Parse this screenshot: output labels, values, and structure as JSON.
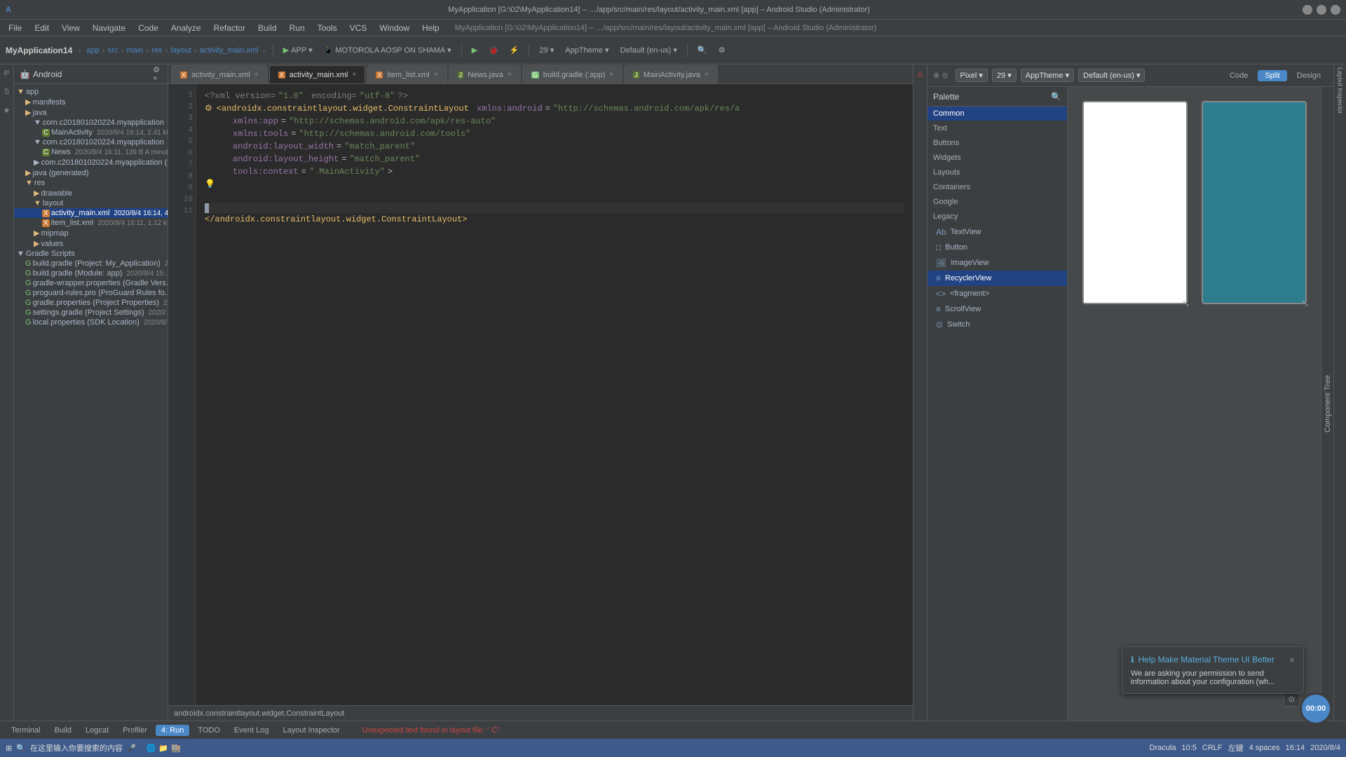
{
  "titleBar": {
    "title": "MyApplication [G:\\02\\MyApplication14] – …/app/src/main/res/layout/activity_main.xml [app] – Android Studio (Administrator)",
    "windowControls": [
      "minimize",
      "maximize",
      "close"
    ]
  },
  "menuBar": {
    "items": [
      "File",
      "Edit",
      "View",
      "Navigate",
      "Code",
      "Analyze",
      "Refactor",
      "Build",
      "Run",
      "Tools",
      "VCS",
      "Window",
      "Help"
    ]
  },
  "toolbar": {
    "appName": "MyApplication14",
    "breadcrumb": [
      "app",
      "src",
      "main",
      "res",
      "layout",
      "activity_main.xml"
    ],
    "runConfig": "APP",
    "device": "MOTOROLA AOSP ON SHAMA",
    "sdkDropdown": "29",
    "themeDropdown": "AppTheme",
    "localeDropdown": "Default (en-us)"
  },
  "projectPanel": {
    "header": "Android",
    "items": [
      {
        "label": "app",
        "indent": 0,
        "type": "root",
        "icon": "▼"
      },
      {
        "label": "manifests",
        "indent": 1,
        "type": "folder",
        "icon": "▶"
      },
      {
        "label": "java",
        "indent": 1,
        "type": "folder",
        "icon": "▶"
      },
      {
        "label": "com.c201801020224.myapplication",
        "indent": 2,
        "type": "package",
        "icon": "▼"
      },
      {
        "label": "MainActivity",
        "indent": 3,
        "type": "java",
        "icon": "C",
        "meta": "2020/8/4 16:14, 2.41 kB"
      },
      {
        "label": "com.c201801020224.myapplication",
        "indent": 2,
        "type": "package2",
        "icon": "▼"
      },
      {
        "label": "News",
        "indent": 3,
        "type": "java",
        "icon": "C",
        "meta": "2020/8/4 16:11, 139 B A minut..."
      },
      {
        "label": "com.c201801020224.myapplication (t...",
        "indent": 2,
        "type": "package3",
        "icon": "▶"
      },
      {
        "label": "java (generated)",
        "indent": 1,
        "type": "folder",
        "icon": "▶"
      },
      {
        "label": "res",
        "indent": 1,
        "type": "folder",
        "icon": "▼"
      },
      {
        "label": "drawable",
        "indent": 2,
        "type": "folder",
        "icon": "▶"
      },
      {
        "label": "layout",
        "indent": 2,
        "type": "folder",
        "icon": "▼"
      },
      {
        "label": "activity_main.xml",
        "indent": 3,
        "type": "xml",
        "icon": "X",
        "meta": "2020/8/4 16:14, 44..."
      },
      {
        "label": "item_list.xml",
        "indent": 3,
        "type": "xml",
        "icon": "X",
        "meta": "2020/8/4 16:11, 1.12 kB"
      },
      {
        "label": "mipmap",
        "indent": 2,
        "type": "folder",
        "icon": "▶"
      },
      {
        "label": "values",
        "indent": 2,
        "type": "folder",
        "icon": "▶"
      },
      {
        "label": "Gradle Scripts",
        "indent": 0,
        "type": "gradle-root",
        "icon": "▼"
      },
      {
        "label": "build.gradle (Project: My_Application)",
        "indent": 1,
        "type": "gradle",
        "icon": "G",
        "meta": "2..."
      },
      {
        "label": "build.gradle (Module: app)",
        "indent": 1,
        "type": "gradle",
        "icon": "G",
        "meta": "2020/8/4 15:..."
      },
      {
        "label": "gradle-wrapper.properties (Gradle Vers...",
        "indent": 1,
        "type": "gradle",
        "icon": "G"
      },
      {
        "label": "proguard-rules.pro (ProGuard Rules fo...",
        "indent": 1,
        "type": "gradle",
        "icon": "G"
      },
      {
        "label": "gradle.properties (Project Properties)",
        "indent": 1,
        "type": "gradle",
        "icon": "G",
        "meta": "2..."
      },
      {
        "label": "settings.gradle (Project Settings)",
        "indent": 1,
        "type": "gradle",
        "icon": "G",
        "meta": "2020/..."
      },
      {
        "label": "local.properties (SDK Location)",
        "indent": 1,
        "type": "gradle",
        "icon": "G",
        "meta": "2020/8/..."
      }
    ]
  },
  "editorTabs": [
    {
      "label": "activity_main.xml",
      "active": true,
      "icon": "X"
    },
    {
      "label": "item_list.xml",
      "active": false,
      "icon": "X"
    },
    {
      "label": "News.java",
      "active": false,
      "icon": "J"
    },
    {
      "label": "build.gradle (:app)",
      "active": false,
      "icon": "G"
    },
    {
      "label": "MainActivity.java",
      "active": false,
      "icon": "J"
    }
  ],
  "codeLines": [
    {
      "num": 1,
      "content": "<?xml version=\"1.0\" encoding=\"utf-8\"?>"
    },
    {
      "num": 2,
      "content": "<androidx.constraintlayout.widget.ConstraintLayout xmlns:android=\"http://schemas.android.com/apk/res/a"
    },
    {
      "num": 3,
      "content": "    xmlns:app=\"http://schemas.android.com/apk/res-auto\""
    },
    {
      "num": 4,
      "content": "    xmlns:tools=\"http://schemas.android.com/tools\""
    },
    {
      "num": 5,
      "content": "    android:layout_width=\"match_parent\""
    },
    {
      "num": 6,
      "content": "    android:layout_height=\"match_parent\""
    },
    {
      "num": 7,
      "content": "    tools:context=\".MainActivity\">"
    },
    {
      "num": 8,
      "content": ""
    },
    {
      "num": 9,
      "content": ""
    },
    {
      "num": 10,
      "content": ""
    },
    {
      "num": 11,
      "content": "</androidx.constraintlayout.widget.ConstraintLayout>"
    }
  ],
  "palette": {
    "header": "Palette",
    "searchPlaceholder": "Search...",
    "categories": [
      "Common",
      "Text",
      "Buttons",
      "Widgets",
      "Layouts",
      "Containers",
      "Google",
      "Legacy"
    ],
    "selectedCategory": "Common",
    "items": [
      {
        "label": "TextView",
        "icon": "Ab"
      },
      {
        "label": "Button",
        "icon": "□"
      },
      {
        "label": "ImageView",
        "icon": "🖼"
      },
      {
        "label": "RecyclerView",
        "icon": "≡"
      },
      {
        "label": "<fragment>",
        "icon": "<>"
      },
      {
        "label": "ScrollView",
        "icon": "≡"
      },
      {
        "label": "Switch",
        "icon": "⊙"
      }
    ],
    "selectedItem": "RecyclerView"
  },
  "designToolbar": {
    "modes": [
      "Code",
      "Split",
      "Design"
    ],
    "activeMode": "Split",
    "pixelDropdown": "Pixel",
    "sdkDropdown": "29",
    "themeDropdown": "AppTheme",
    "localeDropdown": "Default (en-us)"
  },
  "componentTree": {
    "label": "Component Tree"
  },
  "bottomBar": {
    "path": "androidx.constraintlayout.widget.ConstraintLayout",
    "statusText": "Unexpected text found in layout file: \" C\"",
    "statusTabs": [
      "Terminal",
      "Build",
      "Logcat",
      "Profiler"
    ],
    "rightInfo": {
      "run": "4: Run",
      "todo": "TODO"
    }
  },
  "ideStatusBar": {
    "theme": "Dracula",
    "line": "10",
    "col": "5",
    "lineEnding": "CRLF",
    "encoding": "左键",
    "spaces": "4 spaces",
    "time": "16:14",
    "date": "2020/8/4"
  },
  "notification": {
    "title": "Help Make Material Theme UI Better",
    "icon": "ℹ",
    "body": "We are asking your permission to send information about your configuration (wh...",
    "timer": "00:00"
  },
  "colors": {
    "accent": "#4a88c7",
    "teal": "#2e7d8e",
    "selectedBg": "#214283",
    "toolbar": "#3c3f41",
    "editor": "#2b2b2b"
  }
}
